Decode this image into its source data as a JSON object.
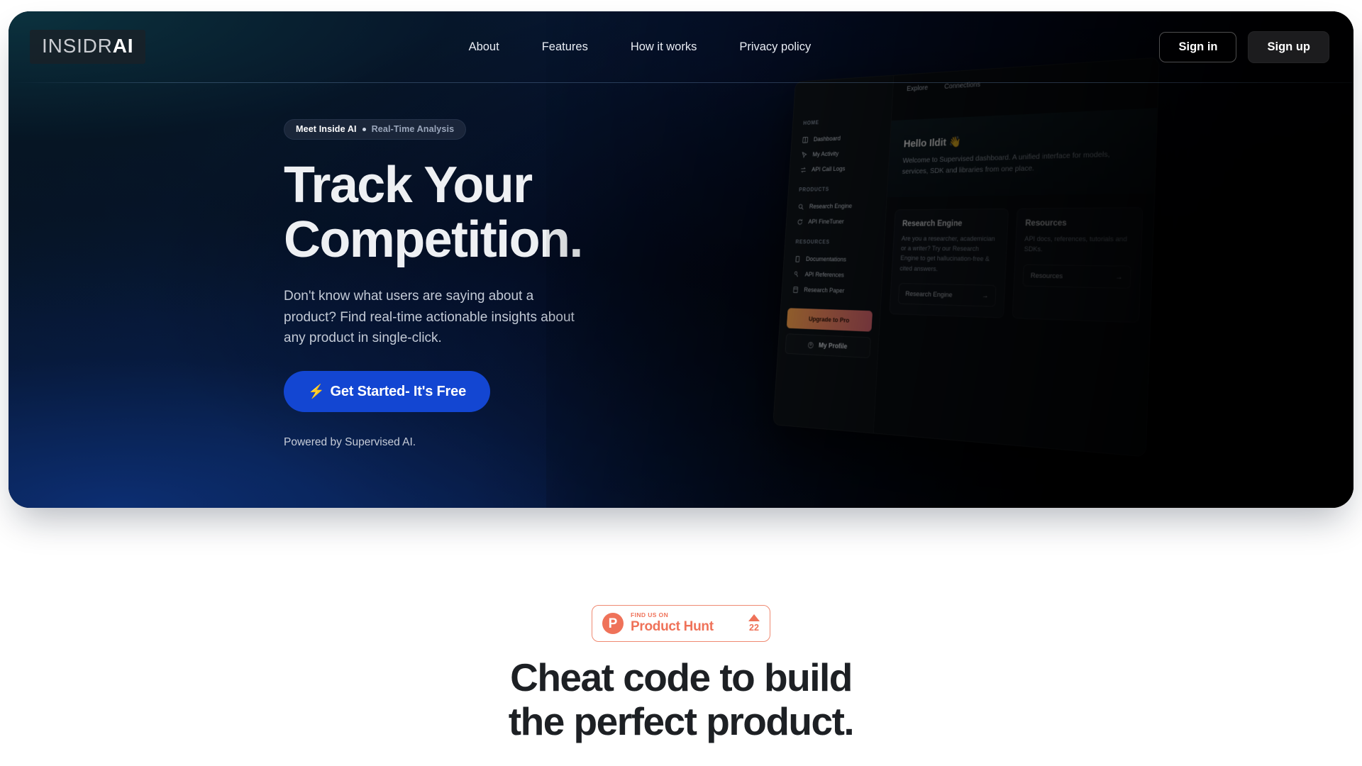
{
  "brand": {
    "name_light": "INSIDR",
    "name_bold": "AI"
  },
  "nav": {
    "links": [
      {
        "label": "About"
      },
      {
        "label": "Features"
      },
      {
        "label": "How it works"
      },
      {
        "label": "Privacy policy"
      }
    ],
    "sign_in": "Sign in",
    "sign_up": "Sign up"
  },
  "hero": {
    "badge_strong": "Meet Inside AI",
    "badge_sub": "Real-Time Analysis",
    "title_line1": "Track Your",
    "title_line2": "Competition.",
    "subtitle": "Don't know what users are saying about a product? Find real-time actionable insights about any product in single-click.",
    "cta_icon": "⚡",
    "cta_label": "Get Started- It's Free",
    "powered_by": "Powered by Supervised AI."
  },
  "mockup": {
    "sidebar": {
      "groups": [
        {
          "label": "HOME",
          "items": [
            {
              "label": "Dashboard",
              "icon": "grid-icon"
            },
            {
              "label": "My Activity",
              "icon": "cursor-icon"
            },
            {
              "label": "API Call Logs",
              "icon": "transfer-icon"
            }
          ]
        },
        {
          "label": "PRODUCTS",
          "items": [
            {
              "label": "Research Engine",
              "icon": "search-icon"
            },
            {
              "label": "API FineTuner",
              "icon": "refresh-icon"
            }
          ]
        },
        {
          "label": "RESOURCES",
          "items": [
            {
              "label": "Documentations",
              "icon": "book-icon"
            },
            {
              "label": "API References",
              "icon": "key-icon"
            },
            {
              "label": "Research Paper",
              "icon": "file-icon"
            }
          ]
        }
      ],
      "upgrade_label": "Upgrade to Pro",
      "profile_label": "My Profile"
    },
    "tabs": [
      {
        "label": "Explore"
      },
      {
        "label": "Connections"
      }
    ],
    "greeting": "Hello Ildit 👋",
    "description": "Welcome to Supervised dashboard. A unified interface for models, services, SDK and libraries from one place.",
    "cards": [
      {
        "title": "Research Engine",
        "body": "Are you a researcher, academician or a writer? Try our Research Engine to get hallucination-free & cited answers.",
        "link_label": "Research Engine"
      },
      {
        "title": "Resources",
        "body": "API docs, references, tutorials and SDKs.",
        "link_label": "Resources"
      }
    ]
  },
  "product_hunt": {
    "find_us_on": "FIND US ON",
    "name": "Product Hunt",
    "upvotes": "22"
  },
  "section2": {
    "heading_line1": "Cheat code to build",
    "heading_line2": "the perfect product."
  },
  "colors": {
    "accent_blue": "#1346d2",
    "product_hunt": "#ef7259",
    "upgrade_gradient_start": "#f7a14b",
    "upgrade_gradient_end": "#f6737f"
  }
}
